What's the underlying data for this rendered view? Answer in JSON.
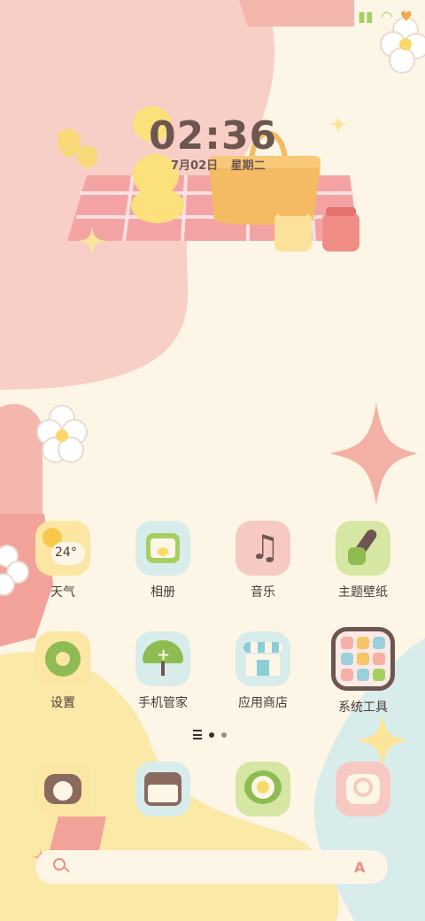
{
  "clock": {
    "time": "02:36",
    "date": "7月02日  星期二"
  },
  "status_bar": {
    "icons": [
      "signal-icon",
      "wifi-icon",
      "bell-icon"
    ]
  },
  "weather_widget": {
    "temperature": "24°"
  },
  "apps_row1": [
    {
      "label": "天气"
    },
    {
      "label": "相册"
    },
    {
      "label": "音乐"
    },
    {
      "label": "主题壁纸"
    }
  ],
  "apps_row2": [
    {
      "label": "设置"
    },
    {
      "label": "手机管家"
    },
    {
      "label": "应用商店"
    },
    {
      "label": "系统工具"
    }
  ],
  "page_indicator": {
    "pages": 2,
    "active": 1
  },
  "dock": [
    "phone-icon",
    "messages-icon",
    "browser-icon",
    "camera-icon"
  ],
  "colors": {
    "background": "#fdf6e6",
    "pink": "#f5cdc4",
    "yellow": "#fbe9a8",
    "blue": "#d9ecec",
    "text": "#4a3b37",
    "clock": "#6e5650"
  }
}
